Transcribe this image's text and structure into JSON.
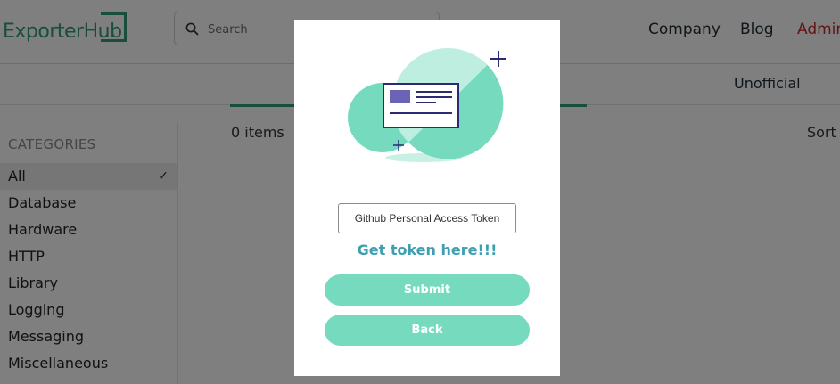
{
  "header": {
    "logo_text": "ExporterHub",
    "search": {
      "placeholder": "Search",
      "value": ""
    },
    "nav": {
      "company": "Company",
      "blog": "Blog",
      "admin": "Admin"
    }
  },
  "subbar": {
    "tab_label": "Unofficial"
  },
  "sidebar": {
    "title": "CATEGORIES",
    "items": [
      {
        "label": "All",
        "selected": true
      },
      {
        "label": "Database"
      },
      {
        "label": "Hardware"
      },
      {
        "label": "HTTP"
      },
      {
        "label": "Library"
      },
      {
        "label": "Logging"
      },
      {
        "label": "Messaging"
      },
      {
        "label": "Miscellaneous"
      }
    ]
  },
  "main": {
    "items_count": "0 items",
    "sort_label": "Sort by"
  },
  "modal": {
    "token_placeholder": "Github Personal Access Token",
    "token_value": "",
    "get_token_link": "Get token here!!!",
    "submit_label": "Submit",
    "back_label": "Back",
    "icons": [
      "id-card-illustration",
      "plus-sparkle-icon"
    ]
  },
  "colors": {
    "brand_green": "#2f9e78",
    "button_mint": "#76dbbe",
    "link_teal": "#3d9fb0",
    "admin_red": "#c62828",
    "overlay": "rgba(0,0,0,0.5)"
  }
}
